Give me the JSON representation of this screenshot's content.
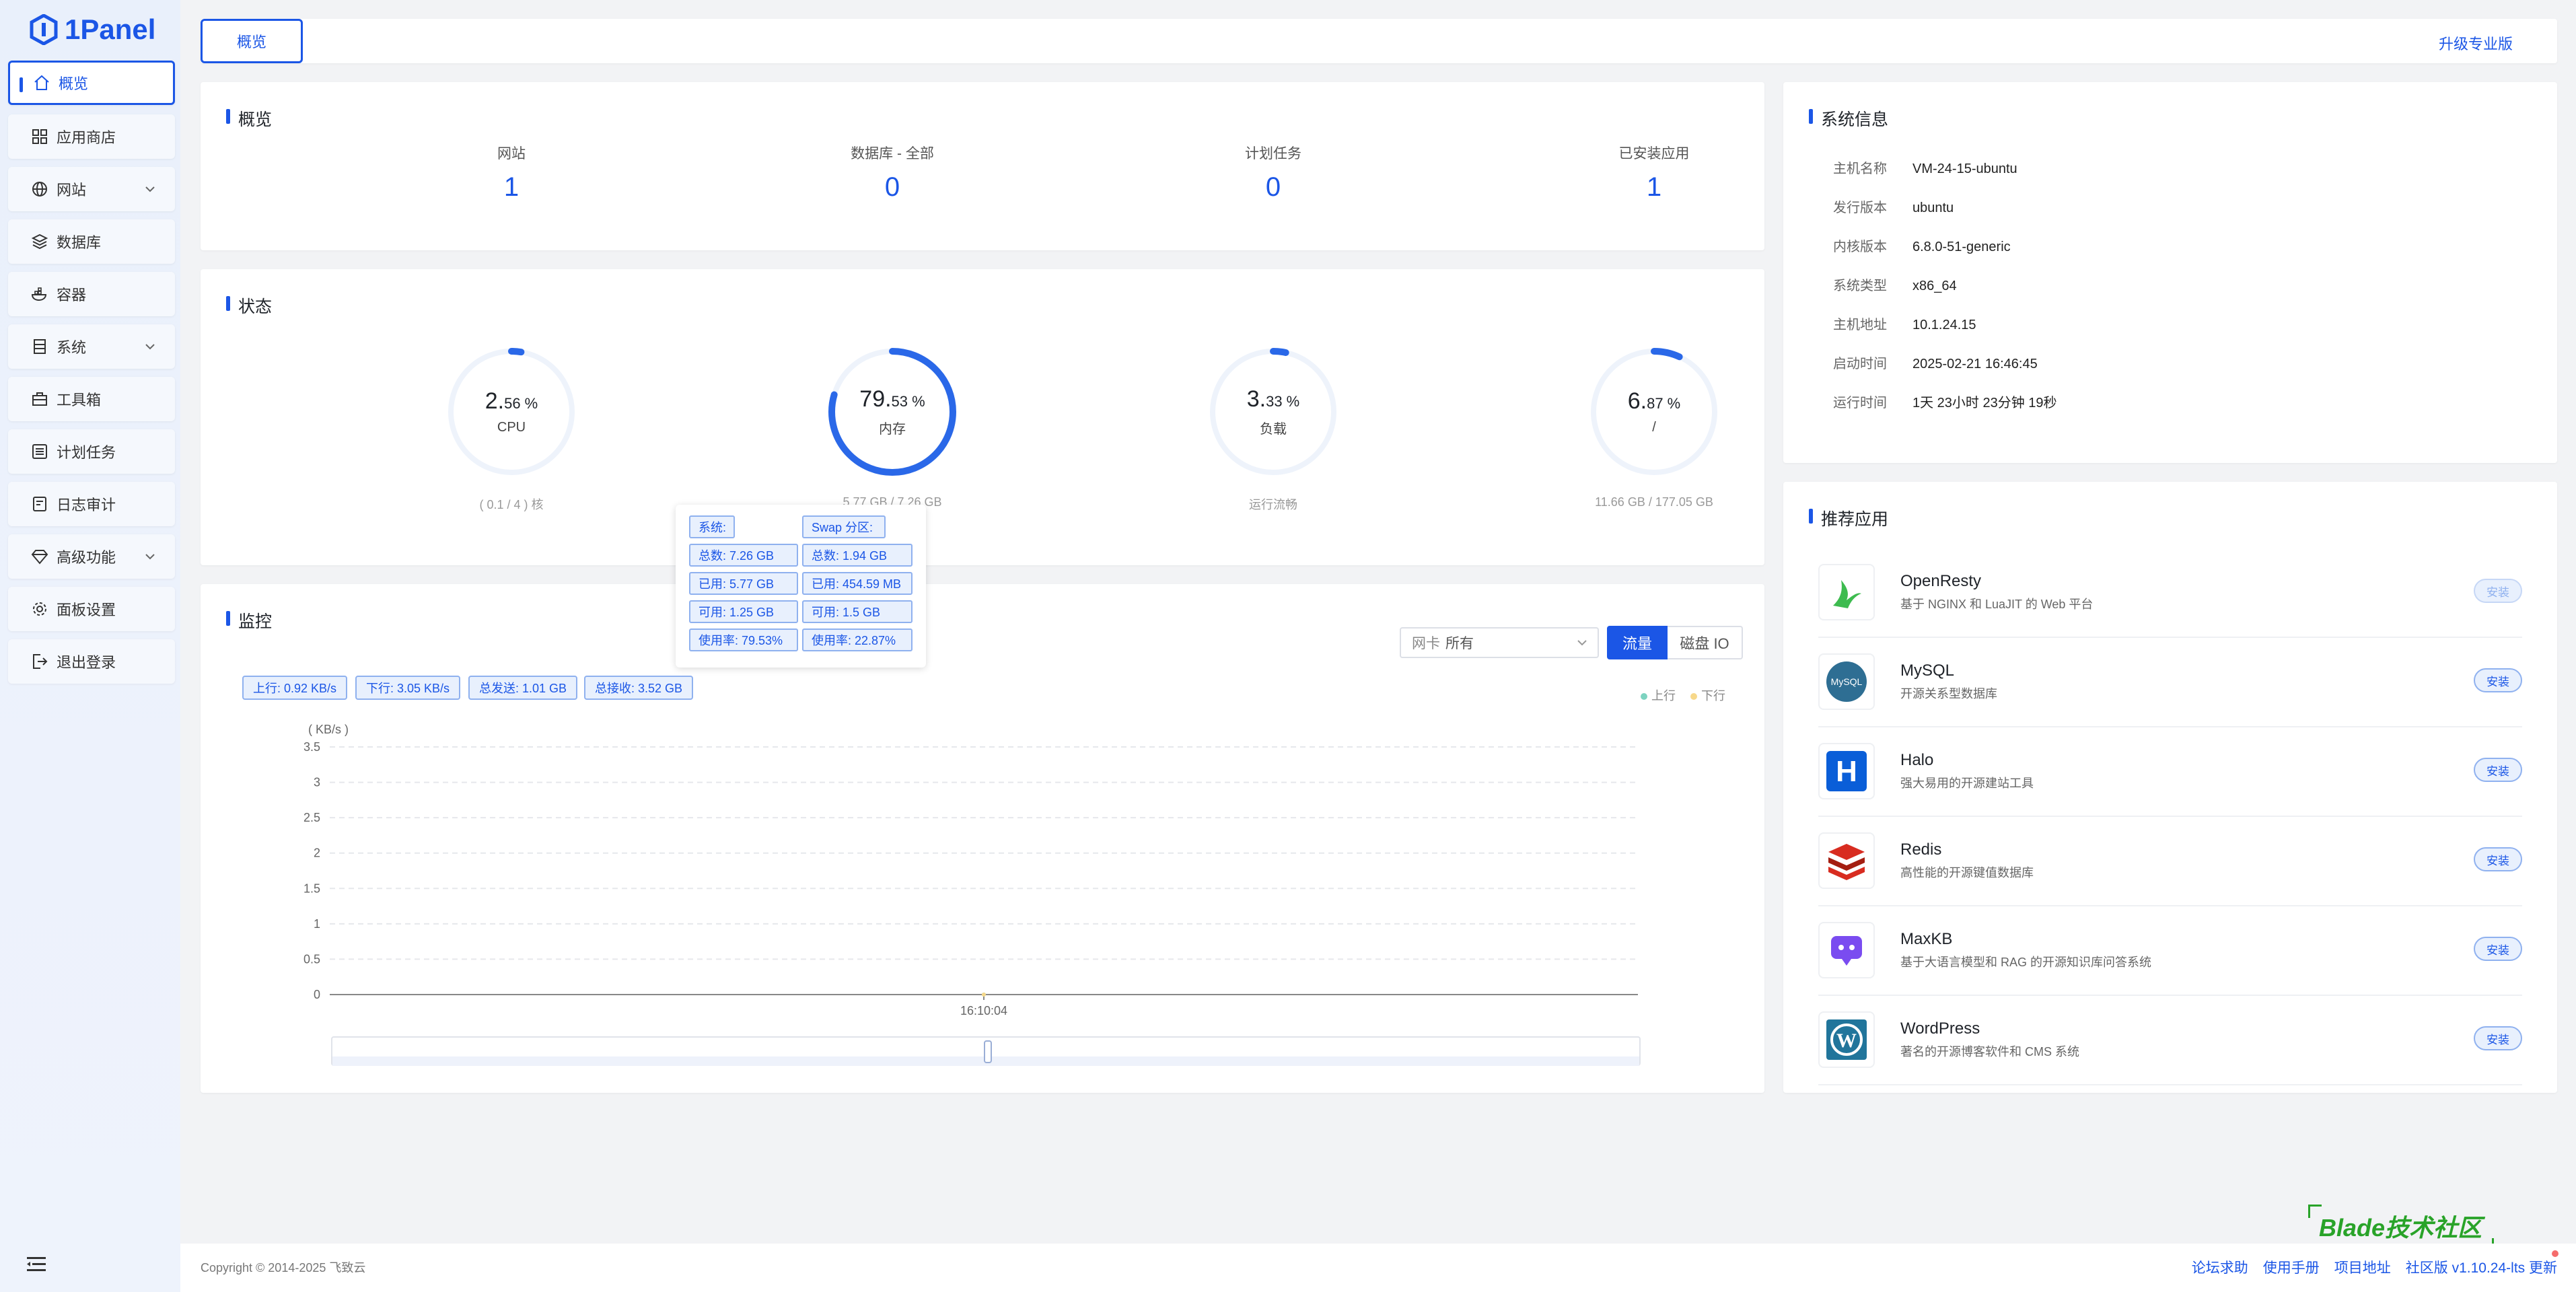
{
  "brand": {
    "name": "1Panel",
    "color": "#1b56e6"
  },
  "sidebar": {
    "items": [
      {
        "label": "概览",
        "icon": "home-icon"
      },
      {
        "label": "应用商店",
        "icon": "grid-icon"
      },
      {
        "label": "网站",
        "icon": "globe-icon"
      },
      {
        "label": "数据库",
        "icon": "layers-icon"
      },
      {
        "label": "容器",
        "icon": "whale-icon"
      },
      {
        "label": "系统",
        "icon": "server-icon"
      },
      {
        "label": "工具箱",
        "icon": "toolbox-icon"
      },
      {
        "label": "计划任务",
        "icon": "list-icon"
      },
      {
        "label": "日志审计",
        "icon": "log-icon"
      },
      {
        "label": "高级功能",
        "icon": "diamond-icon"
      },
      {
        "label": "面板设置",
        "icon": "gear-icon"
      },
      {
        "label": "退出登录",
        "icon": "logout-icon"
      }
    ]
  },
  "topbar": {
    "tab": "概览",
    "upgrade": "升级专业版"
  },
  "overview": {
    "title": "概览",
    "stats": [
      {
        "label": "网站",
        "value": "1"
      },
      {
        "label": "数据库 - 全部",
        "value": "0"
      },
      {
        "label": "计划任务",
        "value": "0"
      },
      {
        "label": "已安装应用",
        "value": "1"
      }
    ]
  },
  "status": {
    "title": "状态",
    "gauges": [
      {
        "int": "2.",
        "dec": "56 %",
        "label": "CPU",
        "percent": 2.56,
        "foot": "( 0.1 / 4 ) 核"
      },
      {
        "int": "79.",
        "dec": "53 %",
        "label": "内存",
        "percent": 79.53,
        "foot": "5.77 GB / 7.26 GB"
      },
      {
        "int": "3.",
        "dec": "33 %",
        "label": "负载",
        "percent": 3.33,
        "foot": "运行流畅"
      },
      {
        "int": "6.",
        "dec": "87 %",
        "label": "/",
        "percent": 6.87,
        "foot": "11.66 GB / 177.05 GB"
      }
    ]
  },
  "tooltip": {
    "col1": [
      "系统:",
      "总数: 7.26 GB",
      "已用: 5.77 GB",
      "可用: 1.25 GB",
      "使用率: 79.53%"
    ],
    "col2": [
      "Swap 分区:",
      "总数: 1.94 GB",
      "已用: 454.59 MB",
      "可用: 1.5 GB",
      "使用率: 22.87%"
    ]
  },
  "monitor": {
    "title": "监控",
    "nic_label": "网卡",
    "nic_value": "所有",
    "btn_traffic": "流量",
    "btn_diskio": "磁盘 IO",
    "tags": [
      "上行: 0.92 KB/s",
      "下行: 3.05 KB/s",
      "总发送: 1.01 GB",
      "总接收: 3.52 GB"
    ],
    "legend": [
      {
        "name": "上行",
        "color": "#7dd3c0"
      },
      {
        "name": "下行",
        "color": "#f7d88a"
      }
    ]
  },
  "chart_data": {
    "type": "line",
    "ylabel": "( KB/s )",
    "ylim": [
      0,
      3.5
    ],
    "yticks": [
      "0",
      "0.5",
      "1",
      "1.5",
      "2",
      "2.5",
      "3",
      "3.5"
    ],
    "x": [
      "16:10:04"
    ],
    "series": [
      {
        "name": "上行",
        "values": [
          0
        ]
      },
      {
        "name": "下行",
        "values": [
          0
        ]
      }
    ],
    "grid": true,
    "legend_position": "top-right"
  },
  "sysinfo": {
    "title": "系统信息",
    "rows": [
      {
        "k": "主机名称",
        "v": "VM-24-15-ubuntu"
      },
      {
        "k": "发行版本",
        "v": "ubuntu"
      },
      {
        "k": "内核版本",
        "v": "6.8.0-51-generic"
      },
      {
        "k": "系统类型",
        "v": "x86_64"
      },
      {
        "k": "主机地址",
        "v": "10.1.24.15"
      },
      {
        "k": "启动时间",
        "v": "2025-02-21 16:46:45"
      },
      {
        "k": "运行时间",
        "v": "1天 23小时 23分钟 19秒"
      }
    ]
  },
  "apps": {
    "title": "推荐应用",
    "install_label": "安装",
    "items": [
      {
        "name": "OpenResty",
        "desc": "基于 NGINX 和 LuaJIT 的 Web 平台",
        "icon": "openresty-icon"
      },
      {
        "name": "MySQL",
        "desc": "开源关系型数据库",
        "icon": "mysql-icon"
      },
      {
        "name": "Halo",
        "desc": "强大易用的开源建站工具",
        "icon": "halo-icon"
      },
      {
        "name": "Redis",
        "desc": "高性能的开源键值数据库",
        "icon": "redis-icon"
      },
      {
        "name": "MaxKB",
        "desc": "基于大语言模型和 RAG 的开源知识库问答系统",
        "icon": "maxkb-icon"
      },
      {
        "name": "WordPress",
        "desc": "著名的开源博客软件和 CMS 系统",
        "icon": "wordpress-icon"
      }
    ]
  },
  "footer": {
    "copyright": "Copyright © 2014-2025 飞致云",
    "links": [
      "论坛求助",
      "使用手册",
      "项目地址"
    ],
    "edition": "社区版",
    "version": "v1.10.24-lts",
    "update": "更新"
  },
  "watermark": "Blade技术社区"
}
